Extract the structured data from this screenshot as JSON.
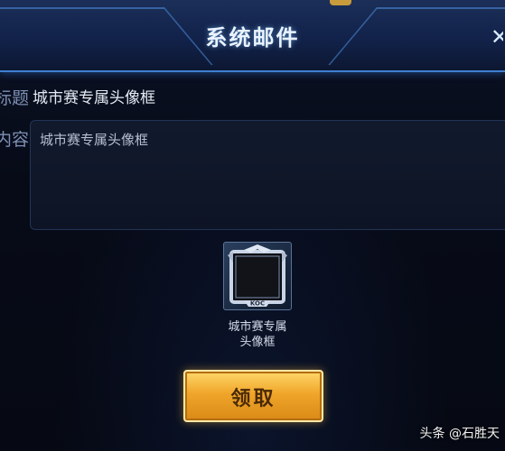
{
  "dialog": {
    "title": "系统邮件",
    "close_icon": "close-icon"
  },
  "mail": {
    "subject_label": "标题",
    "subject_value": "城市赛专属头像框",
    "content_label": "内容",
    "content_text": "城市赛专属头像框"
  },
  "attachment": {
    "icon": "avatar-frame-icon",
    "badge_text": "KOC",
    "name_line1": "城市赛专属",
    "name_line2": "头像框"
  },
  "actions": {
    "claim_label": "领取"
  },
  "watermark": {
    "text": "头条 @石胜天"
  },
  "colors": {
    "accent_blue": "#3f7fd1",
    "button_gold": "#f0a52a"
  }
}
